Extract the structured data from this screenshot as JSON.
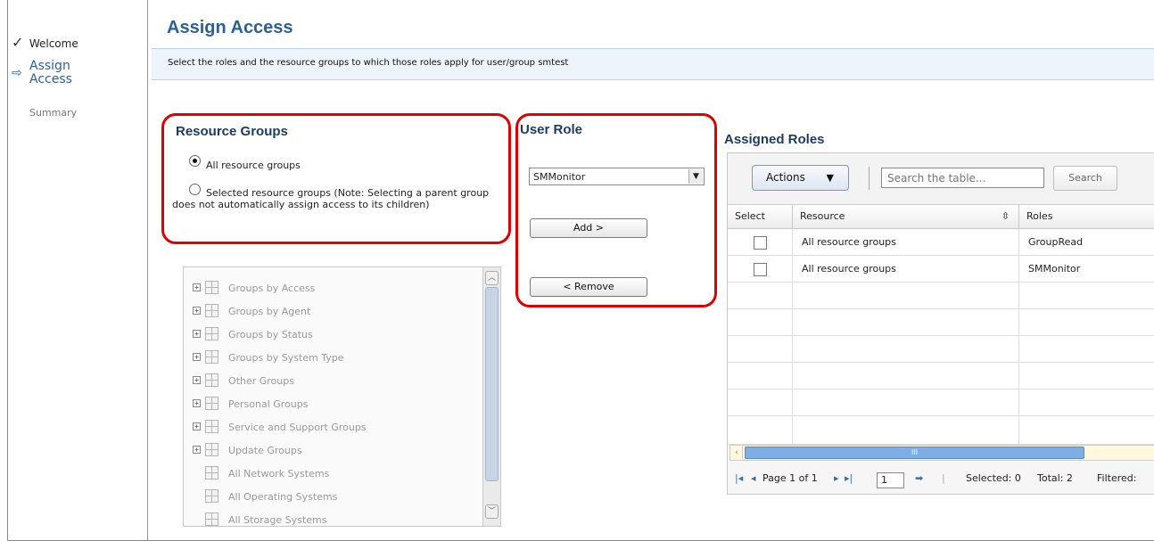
{
  "wizard": {
    "steps": [
      {
        "label": "Welcome",
        "icon": "check-icon"
      },
      {
        "label": "Assign Access",
        "icon": "arrow-right-icon"
      },
      {
        "label": "Summary"
      }
    ]
  },
  "header": {
    "title": "Assign Access",
    "description": "Select the roles and the resource groups to which those roles apply for user/group smtest"
  },
  "resource_groups": {
    "title": "Resource Groups",
    "option_all": "All resource groups",
    "option_selected": "Selected resource groups (Note: Selecting a parent group does not automatically assign access to its children)",
    "selected_option": "all",
    "tree_items": [
      "Groups by Access",
      "Groups by Agent",
      "Groups by Status",
      "Groups by System Type",
      "Other Groups",
      "Personal Groups",
      "Service and Support Groups",
      "Update Groups",
      "All Network Systems",
      "All Operating Systems",
      "All Storage Systems"
    ]
  },
  "user_role": {
    "title": "User Role",
    "selected_role": "SMMonitor",
    "add_label": "Add >",
    "remove_label": "< Remove"
  },
  "assigned_roles": {
    "title": "Assigned Roles",
    "actions_label": "Actions",
    "search_placeholder": "Search the table...",
    "search_label": "Search",
    "columns": [
      "Select",
      "Resource",
      "Roles"
    ],
    "rows": [
      {
        "resource": "All resource groups",
        "roles": "GroupRead"
      },
      {
        "resource": "All resource groups",
        "roles": "SMMonitor"
      }
    ],
    "pager": {
      "page_text": "Page 1 of 1",
      "page_input": "1",
      "selected": "Selected: 0",
      "total": "Total: 2",
      "filtered": "Filtered:"
    }
  },
  "colors": {
    "accent": "#2a5f9e",
    "highlight_border": "#e00000"
  }
}
